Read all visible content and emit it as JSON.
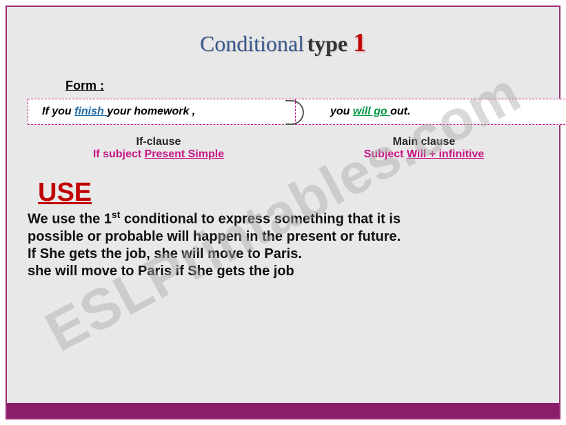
{
  "title": {
    "word1": "Conditional",
    "word2": " type ",
    "word3": "1"
  },
  "form_label": "Form  :",
  "example": {
    "left_pre": "If you ",
    "left_verb": "finish ",
    "left_post": " your homework",
    "comma": " ,",
    "right_pre": "you ",
    "right_verb": "will go ",
    "right_post": "out."
  },
  "clauses": {
    "left_title": "If-clause",
    "left_formula_pre": "If subject  ",
    "left_formula_underline": "Present Simple",
    "right_title": "Main  clause",
    "right_formula_pre": "Subject  ",
    "right_formula_underline": "Will + infinitive"
  },
  "use": {
    "heading": "USE",
    "line1_pre": "We use the 1",
    "line1_sup": "st",
    "line1_post": " conditional to express something that it is",
    "line2": "possible or probable will happen in the present or future.",
    "line3": "If She gets the job, she will move to Paris.",
    "line4": "she will move to Paris if She gets the job"
  },
  "watermark": "ESLPrintables.com"
}
